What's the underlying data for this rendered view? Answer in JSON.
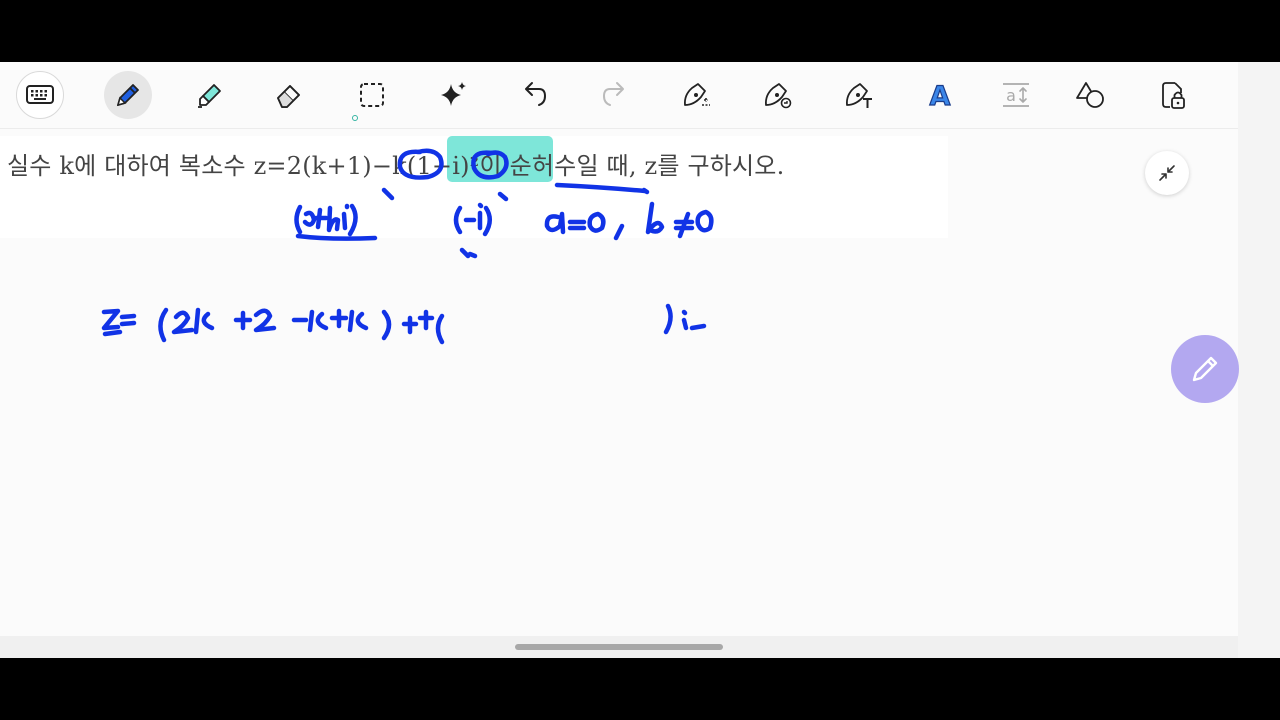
{
  "problem": {
    "text": "실수 k에 대하여 복소수 z=2(k+1)−k(1−i)²이 순허수일 때, z를 구하시오."
  },
  "toolbar": {
    "tools": [
      {
        "name": "keyboard-icon"
      },
      {
        "name": "pen-icon"
      },
      {
        "name": "highlighter-icon"
      },
      {
        "name": "eraser-icon"
      },
      {
        "name": "lasso-select-icon"
      },
      {
        "name": "sparkle-icon"
      },
      {
        "name": "undo-icon"
      },
      {
        "name": "redo-icon"
      },
      {
        "name": "shape-pen-icon"
      },
      {
        "name": "ink-stamp-icon"
      },
      {
        "name": "text-pen-icon"
      },
      {
        "name": "text-style-icon"
      },
      {
        "name": "spacing-icon"
      },
      {
        "name": "shapes-icon"
      },
      {
        "name": "lock-icon"
      }
    ],
    "text_style_glyph": "A",
    "spacing_glyph": "a"
  },
  "colors": {
    "ink": "#1133e6",
    "highlight": "#7ee6d9",
    "fab": "#b3a8f0",
    "selected_tool_bg": "#e6e6e6"
  }
}
